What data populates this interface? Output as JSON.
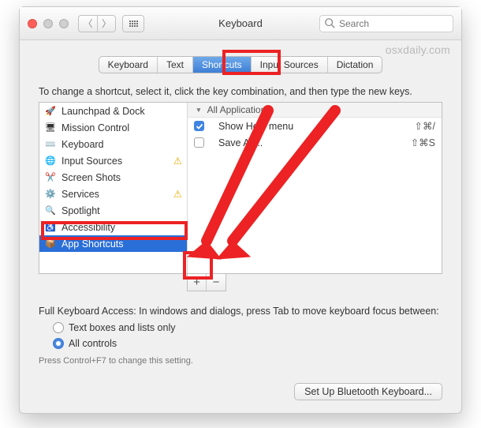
{
  "window": {
    "title": "Keyboard",
    "search_placeholder": "Search"
  },
  "watermark": "osxdaily.com",
  "tabs": {
    "items": [
      "Keyboard",
      "Text",
      "Shortcuts",
      "Input Sources",
      "Dictation"
    ],
    "active_index": 2
  },
  "hint_text": "To change a shortcut, select it, click the key combination, and then type the new keys.",
  "sidebar": {
    "items": [
      {
        "icon": "🚀",
        "label": "Launchpad & Dock",
        "warn": false
      },
      {
        "icon": "🖥",
        "label": "Mission Control",
        "warn": false
      },
      {
        "icon": "⌨️",
        "label": "Keyboard",
        "warn": false
      },
      {
        "icon": "🌐",
        "label": "Input Sources",
        "warn": true
      },
      {
        "icon": "✂️",
        "label": "Screen Shots",
        "warn": false
      },
      {
        "icon": "⚙️",
        "label": "Services",
        "warn": true
      },
      {
        "icon": "🔍",
        "label": "Spotlight",
        "warn": false
      },
      {
        "icon": "♿",
        "label": "Accessibility",
        "warn": false
      },
      {
        "icon": "📦",
        "label": "App Shortcuts",
        "warn": false
      }
    ],
    "selected_index": 8
  },
  "main": {
    "group_header": "All Applications",
    "rows": [
      {
        "checked": true,
        "label": "Show Help menu",
        "shortcut": "⇧⌘/"
      },
      {
        "checked": false,
        "label": "Save As...",
        "shortcut": "⇧⌘S"
      }
    ]
  },
  "add_label": "+",
  "remove_label": "−",
  "keyboard_access": {
    "description": "Full Keyboard Access: In windows and dialogs, press Tab to move keyboard focus between:",
    "options": [
      "Text boxes and lists only",
      "All controls"
    ],
    "selected_index": 1,
    "fine_print": "Press Control+F7 to change this setting."
  },
  "footer_button": "Set Up Bluetooth Keyboard..."
}
